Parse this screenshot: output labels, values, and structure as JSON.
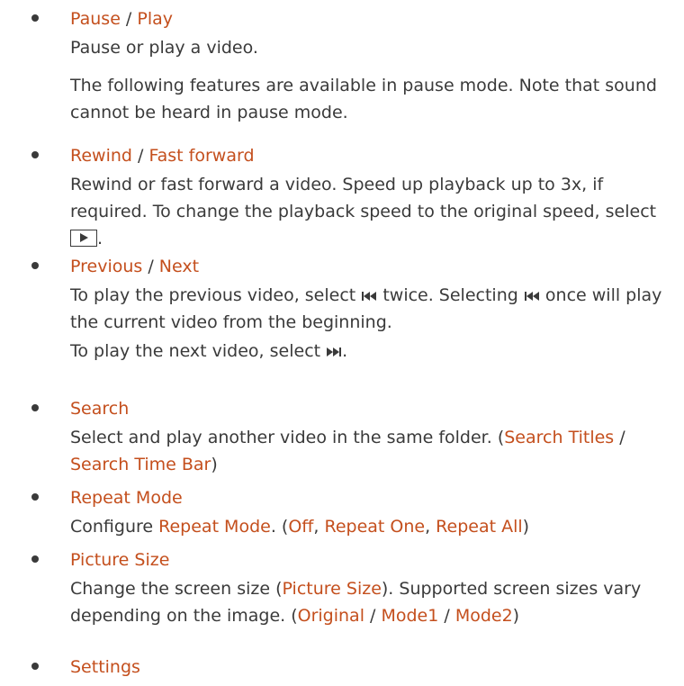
{
  "colors": {
    "accent": "#c44f1d",
    "text": "#3a3a3a"
  },
  "items": [
    {
      "title": [
        "Pause",
        "Play"
      ],
      "desc1": "Pause or play a video.",
      "desc2": "The following features are available in pause mode. Note that sound cannot be heard in pause mode."
    },
    {
      "title": [
        "Rewind",
        "Fast forward"
      ],
      "desc_a": "Rewind or fast forward a video. Speed up playback up to 3x, if required. To change the playback speed to the original speed, select",
      "desc_end": ".",
      "icon": "play-button-icon"
    },
    {
      "title": [
        "Previous",
        "Next"
      ],
      "desc_a": "To play the previous video, select",
      "desc_b": "twice. Selecting",
      "desc_c": "once will play the current video from the beginning.",
      "desc2_a": "To play the next video, select",
      "desc2_end": ".",
      "icon_prev": "previous-track-icon",
      "icon_next": "next-track-icon"
    },
    {
      "title": "Search",
      "desc_a": "Select and play another video in the same folder. (",
      "opt1": "Search Titles",
      "sep": " / ",
      "opt2": "Search Time Bar",
      "desc_end": ")"
    },
    {
      "title": "Repeat Mode",
      "desc_a": "Configure ",
      "ref": "Repeat Mode",
      "desc_b": ". (",
      "opt1": "Off",
      "opt2": "Repeat One",
      "opt3": "Repeat All",
      "comma": ", ",
      "desc_end": ")"
    },
    {
      "title": "Picture Size",
      "desc_a": "Change the screen size (",
      "ref": "Picture Size",
      "desc_b": "). Supported screen sizes vary depending on the image. (",
      "opt1": "Original",
      "opt2": "Mode1",
      "opt3": "Mode2",
      "sep": " / ",
      "desc_end": ")"
    },
    {
      "title": "Settings"
    }
  ],
  "separator": " / "
}
